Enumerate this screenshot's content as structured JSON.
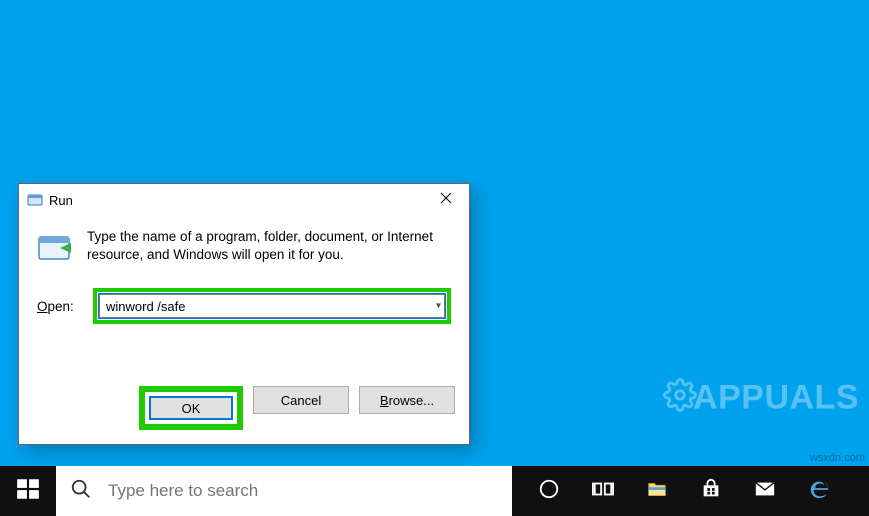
{
  "run_dialog": {
    "title": "Run",
    "instruction": "Type the name of a program, folder, document, or Internet resource, and Windows will open it for you.",
    "open_label": "Open:",
    "open_value": "winword /safe",
    "buttons": {
      "ok": "OK",
      "cancel": "Cancel",
      "browse": "Browse..."
    }
  },
  "taskbar": {
    "search_placeholder": "Type here to search"
  },
  "watermark": {
    "brand": "APPUALS",
    "site": "wsxdn.com"
  }
}
